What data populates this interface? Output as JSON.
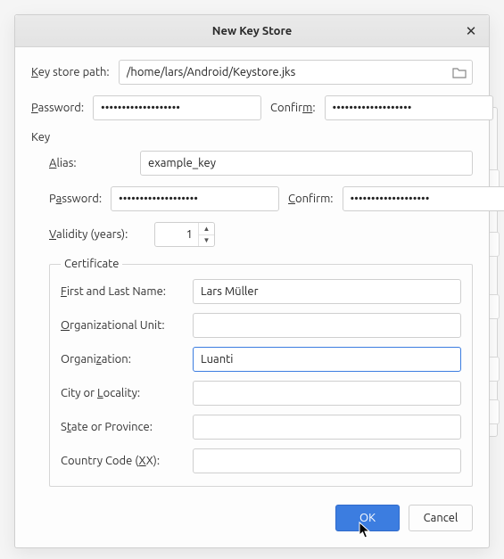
{
  "dialog": {
    "title": "New Key Store",
    "close_glyph": "✕"
  },
  "keystore": {
    "path_label": "Key store path:",
    "path_value": "/home/lars/Android/Keystore.jks",
    "password_label": "Password:",
    "password_value": "•••••••••••••••••••",
    "confirm_label": "Confirm:",
    "confirm_value": "•••••••••••••••••••"
  },
  "key": {
    "section_label": "Key",
    "alias_label": "Alias:",
    "alias_value": "example_key",
    "password_label": "Password:",
    "password_value": "•••••••••••••••••••",
    "confirm_label": "Confirm:",
    "confirm_value": "•••••••••••••••••••",
    "validity_label": "Validity (years):",
    "validity_value": "1"
  },
  "certificate": {
    "legend": "Certificate",
    "first_last_label": "First and Last Name:",
    "first_last_value": "Lars Müller",
    "org_unit_label": "Organizational Unit:",
    "org_unit_value": "",
    "org_label": "Organization:",
    "org_value": "Luanti",
    "city_label": "City or Locality:",
    "city_value": "",
    "state_label": "State or Province:",
    "state_value": "",
    "country_label": "Country Code (XX):",
    "country_value": ""
  },
  "buttons": {
    "ok": "OK",
    "cancel": "Cancel"
  }
}
